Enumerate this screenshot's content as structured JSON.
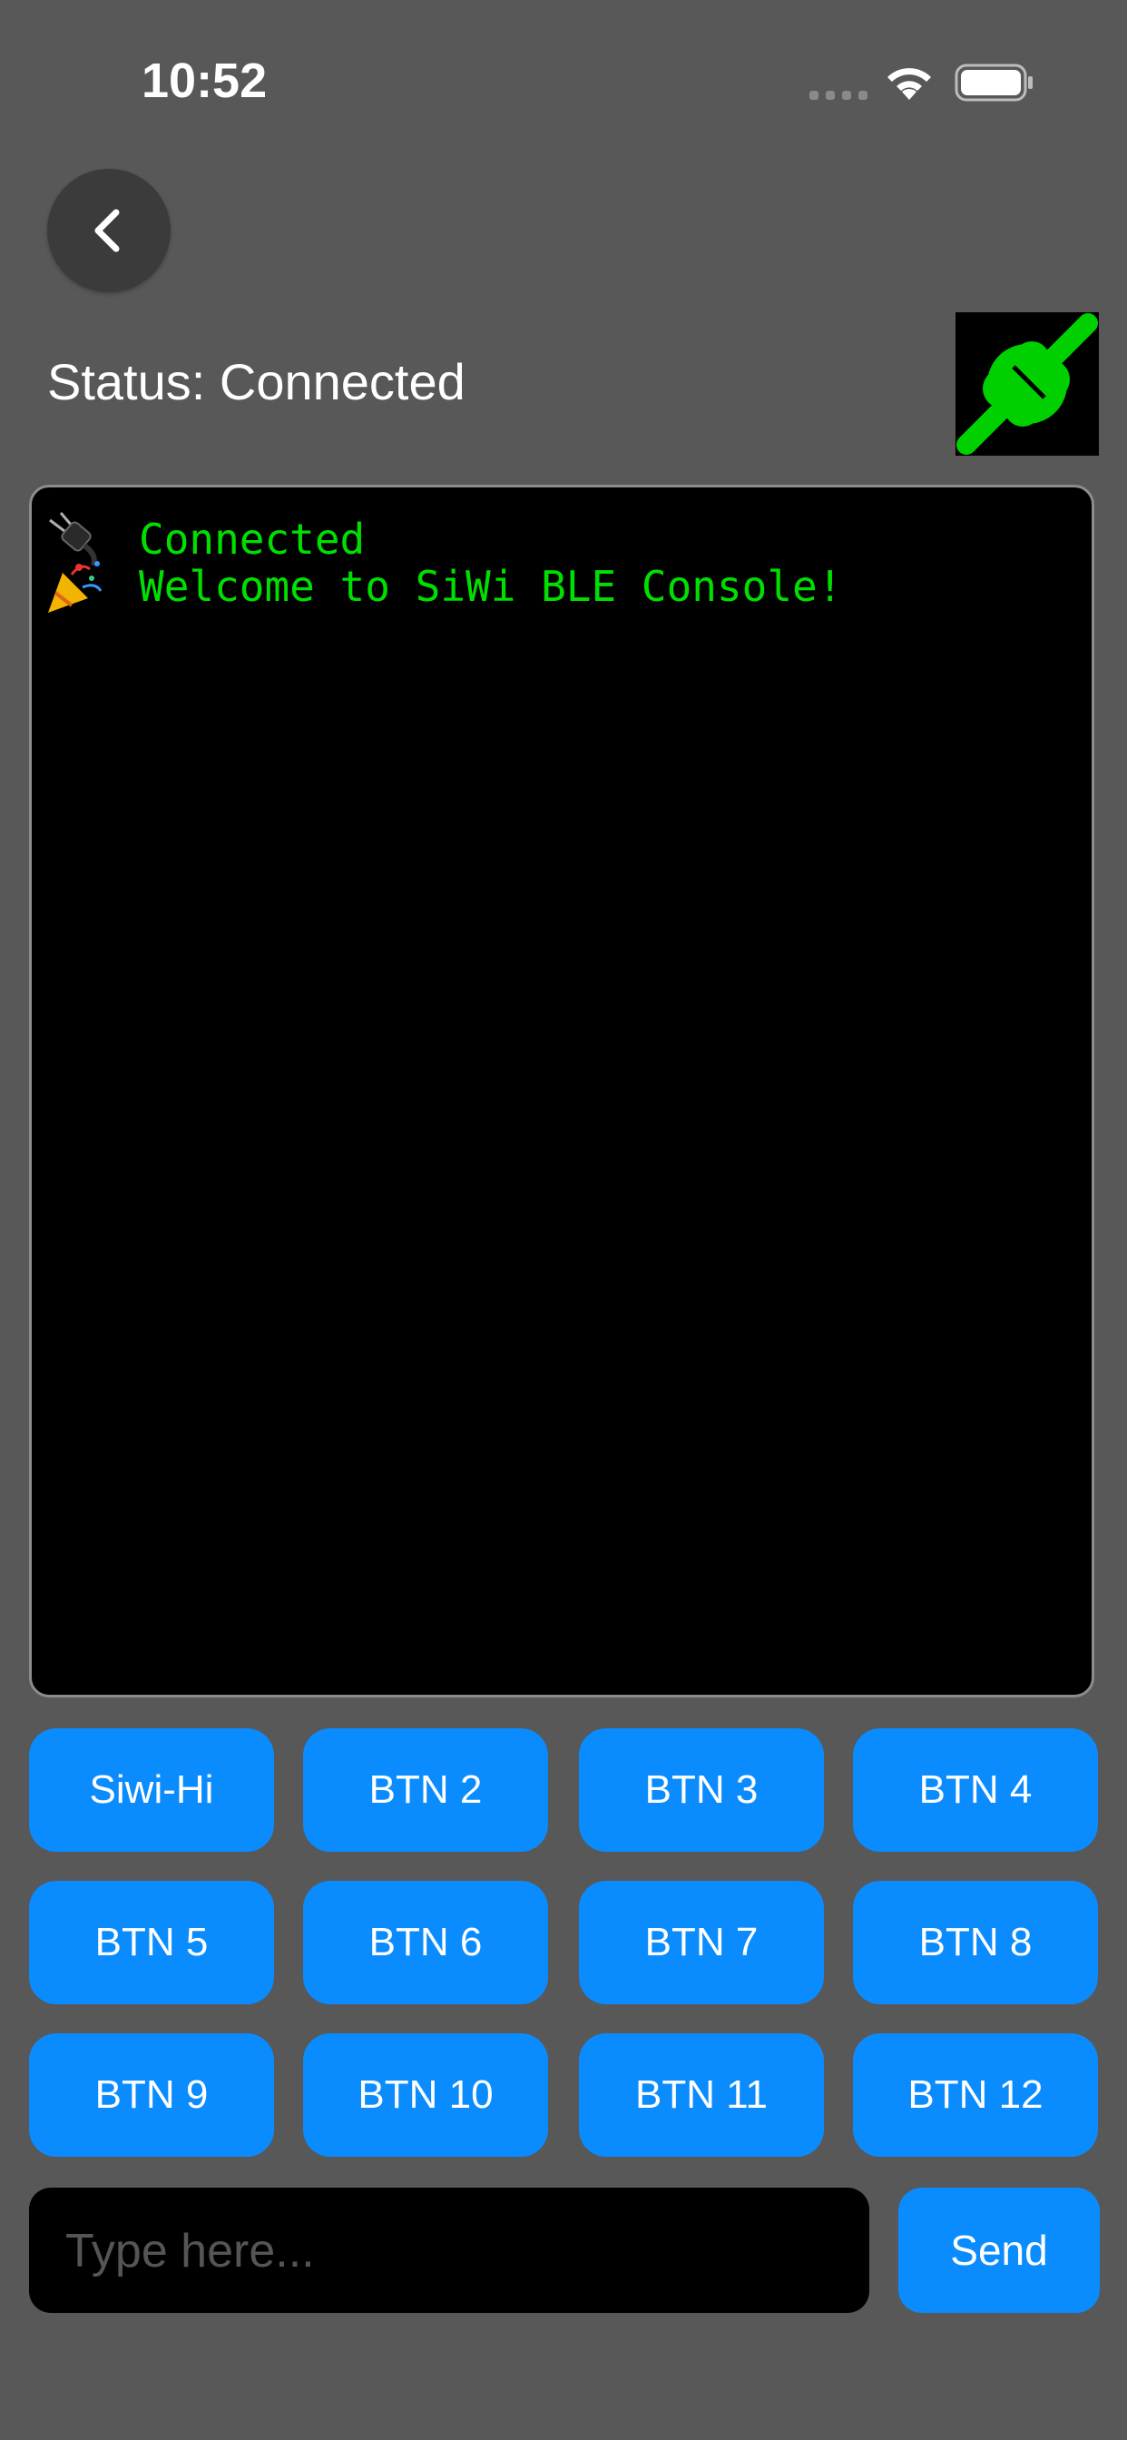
{
  "status_bar": {
    "time": "10:52",
    "icons": [
      "cellular-signal-icon",
      "wifi-icon",
      "battery-icon"
    ]
  },
  "header": {
    "back_icon": "chevron-left-icon",
    "status_text": "Status: Connected",
    "connection_icon": "plug-connected-icon",
    "connection_color": "#00d000"
  },
  "console": {
    "lines": [
      {
        "emoji": "electric-plug-icon",
        "text": "Connected"
      },
      {
        "emoji": "party-popper-icon",
        "text": "Welcome to SiWi BLE Console!"
      }
    ],
    "text_color": "#00e000"
  },
  "buttons": [
    "Siwi-Hi",
    "BTN 2",
    "BTN 3",
    "BTN 4",
    "BTN 5",
    "BTN 6",
    "BTN 7",
    "BTN 8",
    "BTN 9",
    "BTN 10",
    "BTN 11",
    "BTN 12"
  ],
  "input": {
    "placeholder": "Type here...",
    "value": ""
  },
  "send_label": "Send",
  "colors": {
    "background": "#585858",
    "accent": "#0a8cff",
    "console_bg": "#000000"
  }
}
